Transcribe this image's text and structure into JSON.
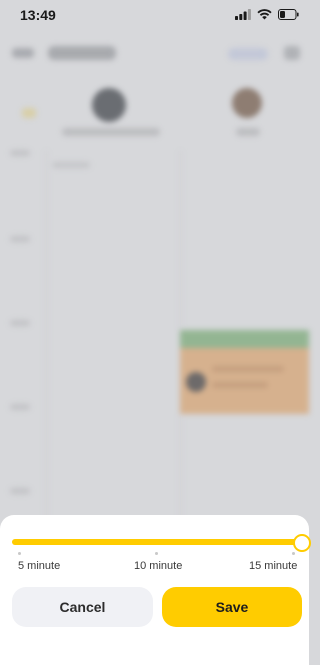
{
  "status_bar": {
    "time": "13:49",
    "icons": [
      "cellular-signal-icon",
      "wifi-icon",
      "battery-icon"
    ]
  },
  "slider": {
    "min_label": "5 minute",
    "mid_label": "10 minute",
    "max_label": "15 minute",
    "value_fraction": 1.0,
    "accent_color": "#FFCC00"
  },
  "actions": {
    "cancel_label": "Cancel",
    "save_label": "Save"
  }
}
